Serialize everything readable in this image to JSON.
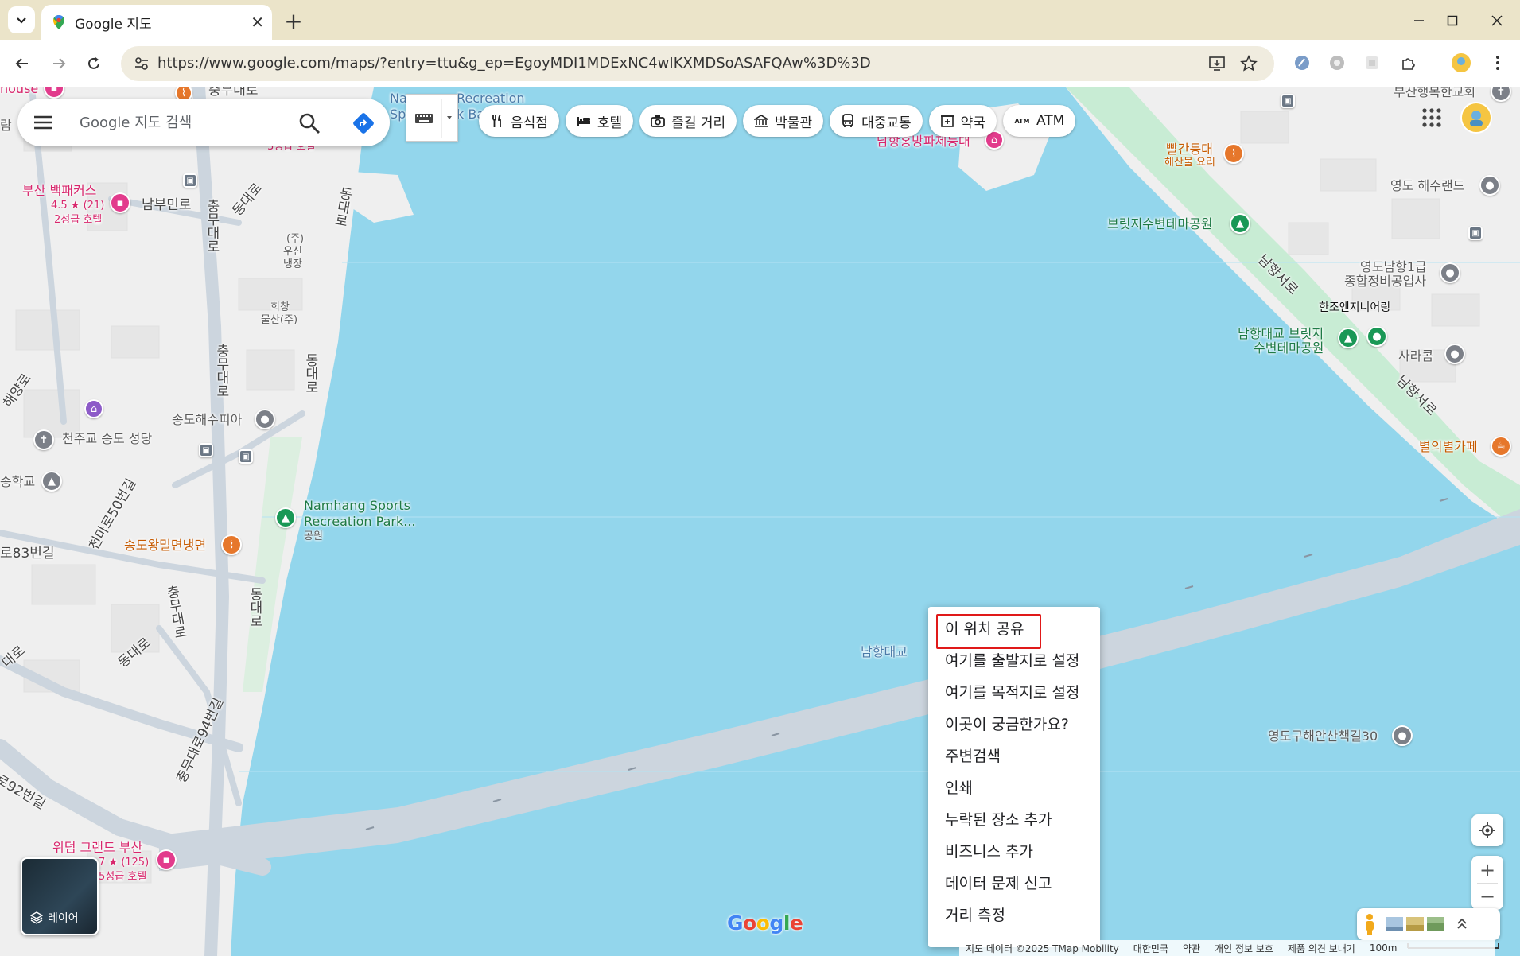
{
  "browser": {
    "tab_title": "Google 지도",
    "url": "https://www.google.com/maps/?entry=ttu&g_ep=EgoyMDI1MDExNC4wIKXMDSoASAFQAw%3D%3D"
  },
  "search": {
    "placeholder": "Google 지도 검색"
  },
  "chips": [
    {
      "label": "음식점",
      "icon": "fork-knife-icon"
    },
    {
      "label": "호텔",
      "icon": "bed-icon"
    },
    {
      "label": "즐길 거리",
      "icon": "camera-icon"
    },
    {
      "label": "박물관",
      "icon": "museum-icon"
    },
    {
      "label": "대중교통",
      "icon": "bus-icon"
    },
    {
      "label": "약국",
      "icon": "pharmacy-icon"
    },
    {
      "label": "ATM",
      "icon": "atm-icon"
    }
  ],
  "context_menu": {
    "items": [
      "이 위치 공유",
      "여기를 출발지로 설정",
      "여기를 목적지로 설정",
      "이곳이 궁금한가요?",
      "주변검색",
      "인쇄",
      "누락된 장소 추가",
      "비즈니스 추가",
      "데이터 문제 신고",
      "거리 측정"
    ]
  },
  "map_labels": {
    "house": "house",
    "ram": "람",
    "chungmu_top": "충무대로",
    "na_rec": "Na",
    "recreation": "Recreation",
    "sp": "Sp",
    "k_ba": "k Ba",
    "hotel3": "3성급 호텔",
    "namhang_museum": "남항홍방파제등대",
    "busan_church": "부산행복한교회",
    "red_light": "빨간등대",
    "red_light_sub": "해산물 요리",
    "yeongdo_haesu": "영도 해수랜드",
    "bridge_park": "브릿지수변테마공원",
    "namhang_seoro1": "남항서로",
    "yeongdo_auto1": "영도남항1급",
    "yeongdo_auto2": "종합정비공업사",
    "hanjo": "한조엔지니어링",
    "namhang_bridge_park1": "남항대교 브릿지",
    "namhang_bridge_park2": "수변테마공원",
    "sarakom": "사라콤",
    "namhang_seoro2": "남항서로",
    "star_cafe": "별의별카페",
    "backpackers": "부산 백패커스",
    "backpackers_rating": "4.5 ★ (21)",
    "backpackers_grade": "2성급 호텔",
    "nambumin": "남부민로",
    "chungmu2": "충무대로",
    "dongdae1": "동대로",
    "dongdae2": "동대로",
    "usin1": "(주)",
    "usin2": "우신",
    "usin3": "냉장",
    "huichang1": "희창",
    "huichang2": "물산(주)",
    "chungmu3": "충무대로",
    "dongdae3": "동대로",
    "haeyang": "해양로",
    "songdo_haesu": "송도해수피아",
    "cathedral": "천주교 송도 성당",
    "school": "송학교",
    "cheonma": "천마로50번길",
    "namhang_sports1": "Namhang Sports",
    "namhang_sports2": "Recreation Park...",
    "namhang_sports3": "공원",
    "gil83": "로83번길",
    "noodle": "송도왕밀면냉면",
    "chungmu4": "충무대로",
    "dongdae4": "동대로",
    "daero": "대로",
    "dongdae5": "동대로",
    "namhang_bridge": "남항대교",
    "chungmu94": "충무대로94번길",
    "gil92": "로92번길",
    "yeongdo_walk": "영도구해안산책길30",
    "wyndham1": "위덤 그랜드 부산",
    "wyndham2": "7 ★ (125)",
    "wyndham3": "5성급 호텔"
  },
  "controls": {
    "layer_label": "레이어",
    "zoom_in": "+",
    "zoom_out": "−"
  },
  "footer": {
    "map_data": "지도 데이터 ©2025 TMap Mobility",
    "country": "대한민국",
    "terms": "약관",
    "privacy": "개인 정보 보호",
    "feedback": "제품 의견 보내기",
    "scale": "100m"
  },
  "colors": {
    "water": "#93d6ec",
    "land": "#f1f1f1",
    "park": "#c8ecd4",
    "road": "#ccd5de",
    "highlight": "#e01919"
  }
}
